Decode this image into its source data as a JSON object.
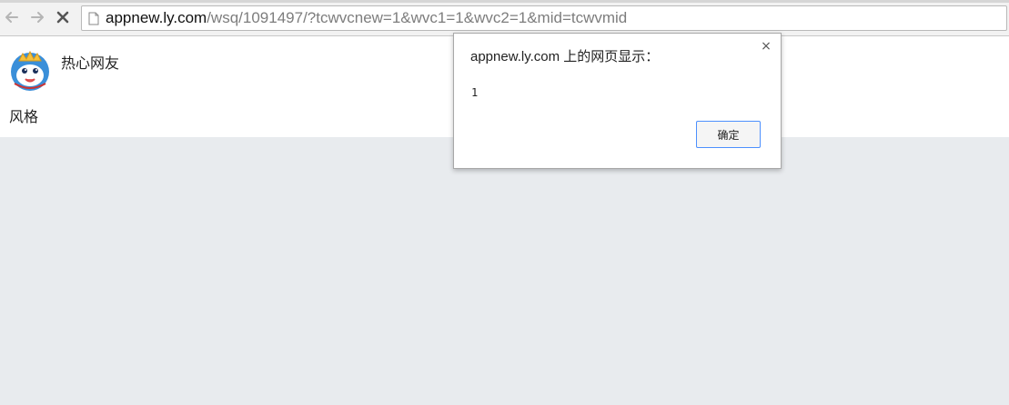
{
  "browser": {
    "url_host": "appnew.ly.com",
    "url_path": "/wsq/1091497/?tcwvcnew=1&wvc1=1&wvc2=1&mid=tcwvmid",
    "icons": {
      "back": "back-arrow-icon",
      "forward": "forward-arrow-icon",
      "stop": "stop-x-icon",
      "page": "page-icon"
    }
  },
  "page": {
    "username": "热心网友",
    "post_text": "风格",
    "avatar": "mascot-avatar"
  },
  "dialog": {
    "title": "appnew.ly.com 上的网页显示：",
    "message": "1",
    "close_glyph": "×",
    "ok_label": "确定"
  },
  "colors": {
    "page_background": "#e8ebee",
    "button_border": "#4d90fe"
  }
}
